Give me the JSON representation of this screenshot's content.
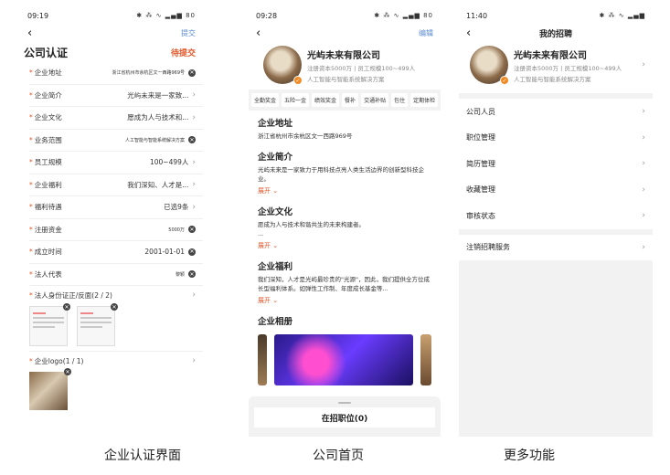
{
  "captions": [
    "企业认证界面",
    "公司首页",
    "更多功能"
  ],
  "screen1": {
    "time": "09:19",
    "status_icons": "✱ ⁂ ∿ ▂▄▆ 80",
    "submit": "提交",
    "title": "公司认证",
    "state": "待提交",
    "rows": [
      {
        "label": "企业地址",
        "value": "浙江省杭州市余杭区文一西路969号",
        "small": true,
        "clear": true
      },
      {
        "label": "企业简介",
        "value": "光屿未来是一家致...",
        "chev": true
      },
      {
        "label": "企业文化",
        "value": "愿成为人与技术和...",
        "chev": true
      },
      {
        "label": "业务范围",
        "value": "人工智能与智能系统解决方案",
        "small": true,
        "clear": true
      },
      {
        "label": "员工规模",
        "value": "100~499人",
        "chev": true
      },
      {
        "label": "企业福利",
        "value": "我们深知、人才是...",
        "chev": true
      },
      {
        "label": "福利待遇",
        "value": "已选9条",
        "chev": true
      },
      {
        "label": "注册资金",
        "value": "5000万",
        "small": true,
        "clear": true
      },
      {
        "label": "成立时间",
        "value": "2001-01-01",
        "clear": true
      },
      {
        "label": "法人代表",
        "value": "黎颖",
        "small": true,
        "clear": true
      }
    ],
    "id_upload": "法人身份证正/反面(2 / 2)",
    "logo_upload": "企业logo(1 / 1)"
  },
  "screen2": {
    "time": "09:28",
    "status_icons": "✱ ⁂ ∿ ▂▄▆ 80",
    "edit": "编辑",
    "company": "光屿未来有限公司",
    "sub1": "注册资本5000万 | 员工规模100~499人",
    "sub2": "人工智能与智能系统解决方案",
    "welfare": [
      "全勤奖金",
      "五险一金",
      "绩效奖金",
      "餐补",
      "交通补贴",
      "包住",
      "定期体检"
    ],
    "addr_t": "企业地址",
    "addr_b": "浙江省杭州市余杭区文一西路969号",
    "intro_t": "企业简介",
    "intro_b": "光屿未来是一家致力于用科技点亮人类生活边界的创新型科技企业。",
    "culture_t": "企业文化",
    "culture_b": "愿成为人与技术和谐共生的未来构建者。",
    "culture_more": "...",
    "fuli_t": "企业福利",
    "fuli_b": "我们深知，人才是光屿最珍贵的\"光源\"，因此，我们提供全方位成长型福利体系。如弹性工作制、年度成长基金等...",
    "expand": "展开",
    "album_t": "企业相册",
    "jobs_btn": "在招职位(0)"
  },
  "screen3": {
    "time": "11:40",
    "status_icons": "✱ ⁂ ∿ ▂▄▆",
    "title": "我的招聘",
    "company": "光屿未来有限公司",
    "sub1": "注册资本5000万 | 员工规模100~499人",
    "sub2": "人工智能与智能系统解决方案",
    "menu": [
      "公司人员",
      "职位管理",
      "简历管理",
      "收藏管理",
      "审核状态"
    ],
    "logout": "注销招聘服务"
  }
}
